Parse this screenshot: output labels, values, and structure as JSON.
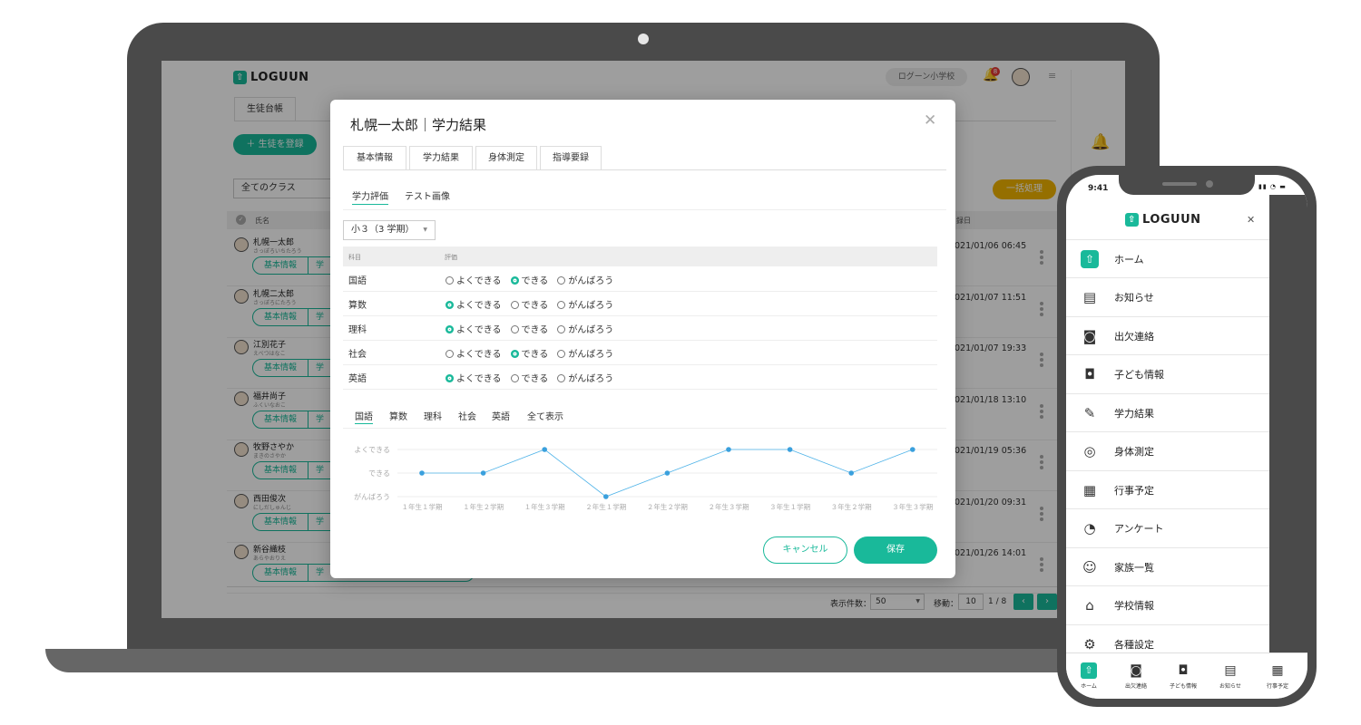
{
  "app": {
    "logo": "LOGUUN",
    "school_name": "ログーン小学校",
    "notification_count": "8"
  },
  "bg": {
    "tab_label": "生徒台帳",
    "register_button": "＋ 生徒を登録",
    "class_filter": "全てのクラス",
    "bulk_button": "一括処理",
    "col_name": "氏名",
    "col_date": "録日",
    "row_button_basic": "基本情報",
    "row_button_partial": "学",
    "students": [
      {
        "name": "札幌一太郎",
        "kana": "さっぽろいちたろう",
        "date": "021/01/06 06:45"
      },
      {
        "name": "札幌二太郎",
        "kana": "さっぽろにたろう",
        "date": "021/01/07 11:51"
      },
      {
        "name": "江別花子",
        "kana": "えべつはなこ",
        "date": "021/01/07 19:33"
      },
      {
        "name": "福井尚子",
        "kana": "ふくいなおこ",
        "date": "021/01/18 13:10"
      },
      {
        "name": "牧野さやか",
        "kana": "まきのさやか",
        "date": "021/01/19 05:36"
      },
      {
        "name": "西田俊次",
        "kana": "にしだしゅんじ",
        "date": "021/01/20 09:31"
      },
      {
        "name": "新谷織枝",
        "kana": "あらやおりえ",
        "date": "021/01/26 14:01"
      }
    ],
    "pagination": {
      "per_page_label": "表示件数：",
      "per_page_value": "50",
      "move_label": "移動：",
      "page_input": "10",
      "page_total": "1 / 8"
    }
  },
  "modal": {
    "title": "札幌一太郎｜学力結果",
    "tabs": [
      "基本情報",
      "学力結果",
      "身体測定",
      "指導要録"
    ],
    "subtabs": [
      "学力評価",
      "テスト画像"
    ],
    "term_select": "小３（3 学期）",
    "table_header": {
      "subject": "科目",
      "rating": "評価"
    },
    "options": [
      "よくできる",
      "できる",
      "がんばろう"
    ],
    "rows": [
      {
        "subject": "国語",
        "selected": 1
      },
      {
        "subject": "算数",
        "selected": 0
      },
      {
        "subject": "理科",
        "selected": 0
      },
      {
        "subject": "社会",
        "selected": 1
      },
      {
        "subject": "英語",
        "selected": 0
      }
    ],
    "chart_tabs": [
      "国語",
      "算数",
      "理科",
      "社会",
      "英語",
      "全て表示"
    ],
    "cancel_button": "キャンセル",
    "save_button": "保存"
  },
  "chart_data": {
    "type": "line",
    "categories": [
      "１年生１学期",
      "１年生２学期",
      "１年生３学期",
      "２年生１学期",
      "２年生２学期",
      "２年生３学期",
      "３年生１学期",
      "３年生２学期",
      "３年生３学期"
    ],
    "y_levels": [
      "がんばろう",
      "できる",
      "よくできる"
    ],
    "values": [
      1,
      1,
      2,
      0,
      1,
      2,
      2,
      1,
      2
    ],
    "ylim": [
      0,
      2
    ],
    "color": "#4fb3e8",
    "grid": true
  },
  "phone": {
    "time": "9:41",
    "logo": "LOGUUN",
    "menu": [
      {
        "label": "ホーム",
        "icon": "home-icon"
      },
      {
        "label": "お知らせ",
        "icon": "news-icon"
      },
      {
        "label": "出欠連絡",
        "icon": "attendance-icon"
      },
      {
        "label": "子ども情報",
        "icon": "child-info-icon"
      },
      {
        "label": "学力結果",
        "icon": "grades-icon"
      },
      {
        "label": "身体測定",
        "icon": "measure-icon"
      },
      {
        "label": "行事予定",
        "icon": "calendar-icon"
      },
      {
        "label": "アンケート",
        "icon": "survey-icon"
      },
      {
        "label": "家族一覧",
        "icon": "family-icon"
      },
      {
        "label": "学校情報",
        "icon": "school-icon"
      },
      {
        "label": "各種設定",
        "icon": "settings-icon"
      }
    ],
    "tabbar": [
      "ホーム",
      "出欠連絡",
      "子ども情報",
      "お知らせ",
      "行事予定"
    ]
  },
  "colors": {
    "accent": "#19b99a",
    "bulk": "#f0b400",
    "bell": "#f0b400"
  }
}
